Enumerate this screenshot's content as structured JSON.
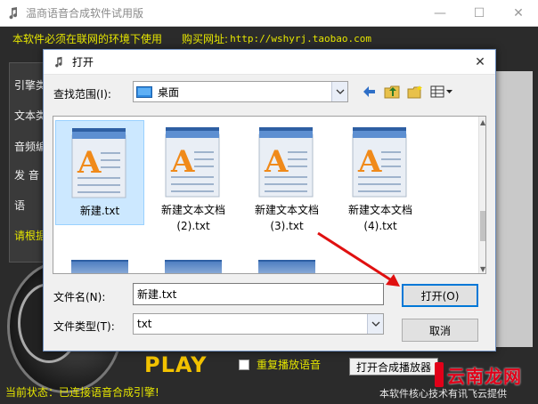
{
  "app": {
    "title": "温商语音合成软件试用版",
    "notice": "本软件必须在联网的环境下使用",
    "buy_label": "购买网址:",
    "buy_url": "http://wshyrj.taobao.com",
    "left_labels": [
      "引擎类",
      "文本类",
      "音频编",
      "发 音",
      "语",
      "请根据"
    ],
    "play": "PLAY",
    "repeat_label": "重复播放语音",
    "open_player": "打开合成播放器",
    "status": "当前状态：已连接语音合成引擎!",
    "footer": "本软件核心技术有讯飞云提供",
    "watermark": "云南龙网"
  },
  "dialog": {
    "title": "打开",
    "lookin_label": "查找范围(I):",
    "lookin_value": "桌面",
    "files": [
      {
        "name": "新建.txt",
        "selected": true
      },
      {
        "name": "新建文本文档\n(2).txt",
        "selected": false
      },
      {
        "name": "新建文本文档\n(3).txt",
        "selected": false
      },
      {
        "name": "新建文本文档\n(4).txt",
        "selected": false
      }
    ],
    "filename_label": "文件名(N):",
    "filename_value": "新建.txt",
    "filetype_label": "文件类型(T):",
    "filetype_value": "txt",
    "open_label": "打开(O)",
    "cancel_label": "取消"
  },
  "colors": {
    "accent_yellow": "#e6e600",
    "arrow_red": "#e01010",
    "selection": "#cce8ff",
    "play_gold": "#f2c200"
  },
  "icons": {
    "file": "text-document-icon",
    "back": "back-arrow-icon",
    "up": "up-folder-icon",
    "new_folder": "new-folder-icon",
    "view": "view-menu-icon"
  }
}
